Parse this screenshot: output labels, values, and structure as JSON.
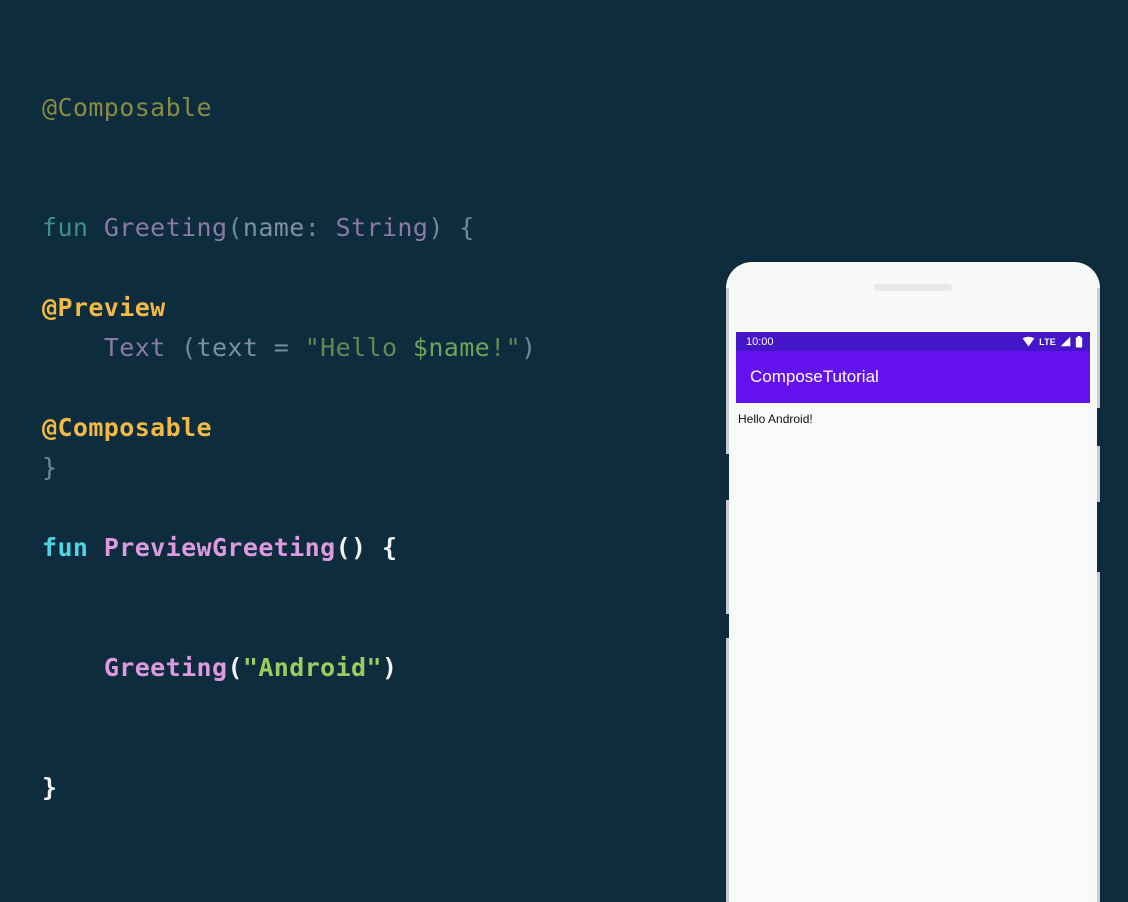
{
  "theme": {
    "background": "#0d2c3d",
    "annotation_dim": "#8a8a45",
    "annotation_bright": "#f2b944",
    "keyword_bright": "#4fd4e3",
    "function_bright": "#dd9ae0",
    "string_bright": "#9ecc60",
    "punct_bright": "#f2f2f2"
  },
  "code": {
    "dim_block": {
      "line1": {
        "annotation": "@Composable"
      },
      "line2": {
        "keyword": "fun ",
        "fnname": "Greeting",
        "open": "(",
        "param": "name",
        "colon": ": ",
        "type": "String",
        "close": ") ",
        "brace": "{"
      },
      "line3": {
        "indent": "    ",
        "call": "Text ",
        "open": "(",
        "arg": "text ",
        "eq": "= ",
        "str_open": "\"Hello ",
        "str_tmpl": "$name",
        "str_close": "!\"",
        "close": ")"
      },
      "line4": {
        "brace": "}"
      }
    },
    "bright_block": {
      "line1": {
        "annotation": "@Preview"
      },
      "line2": {
        "annotation": "@Composable"
      },
      "line3": {
        "keyword": "fun ",
        "fnname": "PreviewGreeting",
        "parens": "() ",
        "brace": "{"
      },
      "line4": {
        "indent": "    ",
        "fnname": "Greeting",
        "open": "(",
        "str": "\"Android\"",
        "close": ")"
      },
      "line5": {
        "brace": "}"
      }
    }
  },
  "phone": {
    "status_bar": {
      "time": "10:00",
      "lte_label": "LTE",
      "icons": [
        "wifi-icon",
        "lte-label",
        "signal-icon",
        "battery-icon"
      ],
      "background": "#4416c8"
    },
    "app_bar": {
      "title": "ComposeTutorial",
      "background": "#6411f0"
    },
    "content": {
      "greeting": "Hello Android!"
    }
  }
}
